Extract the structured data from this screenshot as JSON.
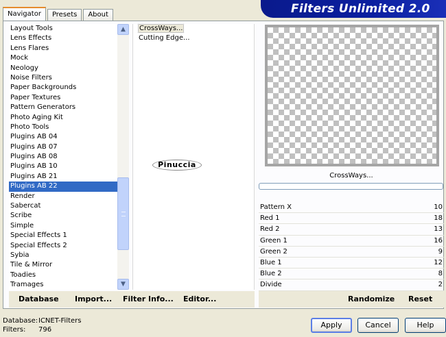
{
  "tabs": [
    "Navigator",
    "Presets",
    "About"
  ],
  "active_tab": "Navigator",
  "banner_title": "Filters Unlimited 2.0",
  "categories": [
    "Layout Tools",
    "Lens Effects",
    "Lens Flares",
    "Mock",
    "Neology",
    "Noise Filters",
    "Paper Backgrounds",
    "Paper Textures",
    "Pattern Generators",
    "Photo Aging Kit",
    "Photo Tools",
    "Plugins AB 04",
    "Plugins AB 07",
    "Plugins AB 08",
    "Plugins AB 10",
    "Plugins AB 21",
    "Plugins AB 22",
    "Render",
    "Sabercat",
    "Scribe",
    "Simple",
    "Special Effects 1",
    "Special Effects 2",
    "Sybia",
    "Tile & Mirror",
    "Toadies",
    "Tramages"
  ],
  "selected_category": "Plugins AB 22",
  "filters": [
    "CrossWays...",
    "Cutting Edge..."
  ],
  "selected_filter": "CrossWays...",
  "watermark_text": "Pinuccia",
  "preview_caption": "CrossWays...",
  "params": [
    {
      "name": "Pattern X",
      "value": "10"
    },
    {
      "name": "Red 1",
      "value": "18"
    },
    {
      "name": "Red 2",
      "value": "13"
    },
    {
      "name": "Green 1",
      "value": "16"
    },
    {
      "name": "Green 2",
      "value": "9"
    },
    {
      "name": "Blue 1",
      "value": "12"
    },
    {
      "name": "Blue 2",
      "value": "8"
    },
    {
      "name": "Divide",
      "value": "2"
    }
  ],
  "left_buttons": {
    "database": "Database",
    "import": "Import...",
    "filter_info": "Filter Info...",
    "editor": "Editor..."
  },
  "right_buttons": {
    "randomize": "Randomize",
    "reset": "Reset"
  },
  "footer": {
    "database_label": "Database:",
    "database_value": "ICNET-Filters",
    "filters_label": "Filters:",
    "filters_value": "796"
  },
  "dialog_buttons": {
    "apply": "Apply",
    "cancel": "Cancel",
    "help": "Help"
  },
  "colors": {
    "selection": "#316ac5",
    "banner": "#0b1fa0",
    "tab_accent": "#e68b2c"
  }
}
